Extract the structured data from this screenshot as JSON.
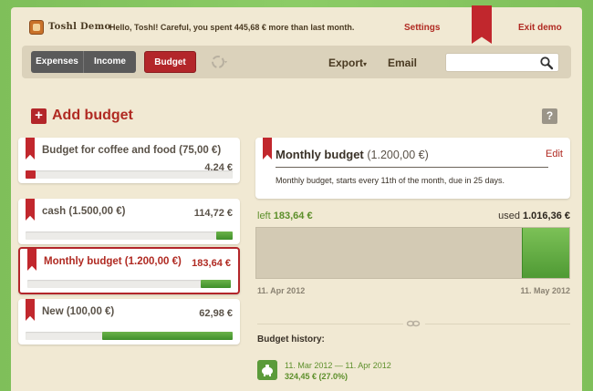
{
  "header": {
    "logo_text": "Toshl Demo",
    "greeting": "Hello, Toshl! Careful, you spent 445,68 € more than last month.",
    "settings": "Settings",
    "exit": "Exit demo"
  },
  "nav": {
    "expenses": "Expenses",
    "income": "Income",
    "budget": "Budget",
    "export": "Export",
    "export_arrow": "▾",
    "email": "Email",
    "search_value": "",
    "sync_icon": "sync-icon"
  },
  "add_budget": {
    "label": "Add budget",
    "plus": "+",
    "help": "?"
  },
  "budgets": [
    {
      "name": "Budget for coffee and food (75,00 €)",
      "amount": "4,24 €",
      "fill_fraction": 0.05,
      "fill_color": "#c1272d",
      "fill_side": "left"
    },
    {
      "name": "cash (1.500,00 €)",
      "amount": "114,72 €",
      "fill_fraction": 0.08,
      "fill_color": "#4f9a34",
      "fill_side": "right"
    },
    {
      "name": "Monthly budget (1.200,00 €)",
      "amount": "183,64 €",
      "fill_fraction": 0.15,
      "fill_color": "#4f9a34",
      "fill_side": "right",
      "active": true
    },
    {
      "name": "New (100,00 €)",
      "amount": "62,98 €",
      "fill_fraction": 0.63,
      "fill_color": "#4f9a34",
      "fill_side": "right"
    }
  ],
  "detail": {
    "title": "Monthly budget",
    "limit": "(1.200,00 €)",
    "edit": "Edit",
    "description": "Monthly budget, starts every 11th of the month, due in 25 days.",
    "left_label": "left",
    "left_amount": "183,64 €",
    "used_label": "used",
    "used_amount": "1.016,36 €",
    "used_fraction": 0.153,
    "start_date": "11. Apr 2012",
    "end_date": "11. May 2012"
  },
  "history": {
    "title": "Budget history:",
    "items": [
      {
        "range": "11. Mar 2012 — 11. Apr 2012",
        "amount": "324,45 € (27.0%)"
      }
    ]
  },
  "colors": {
    "accent_red": "#b3262a",
    "accent_green": "#4f9a34",
    "background": "#f1e9d3"
  }
}
